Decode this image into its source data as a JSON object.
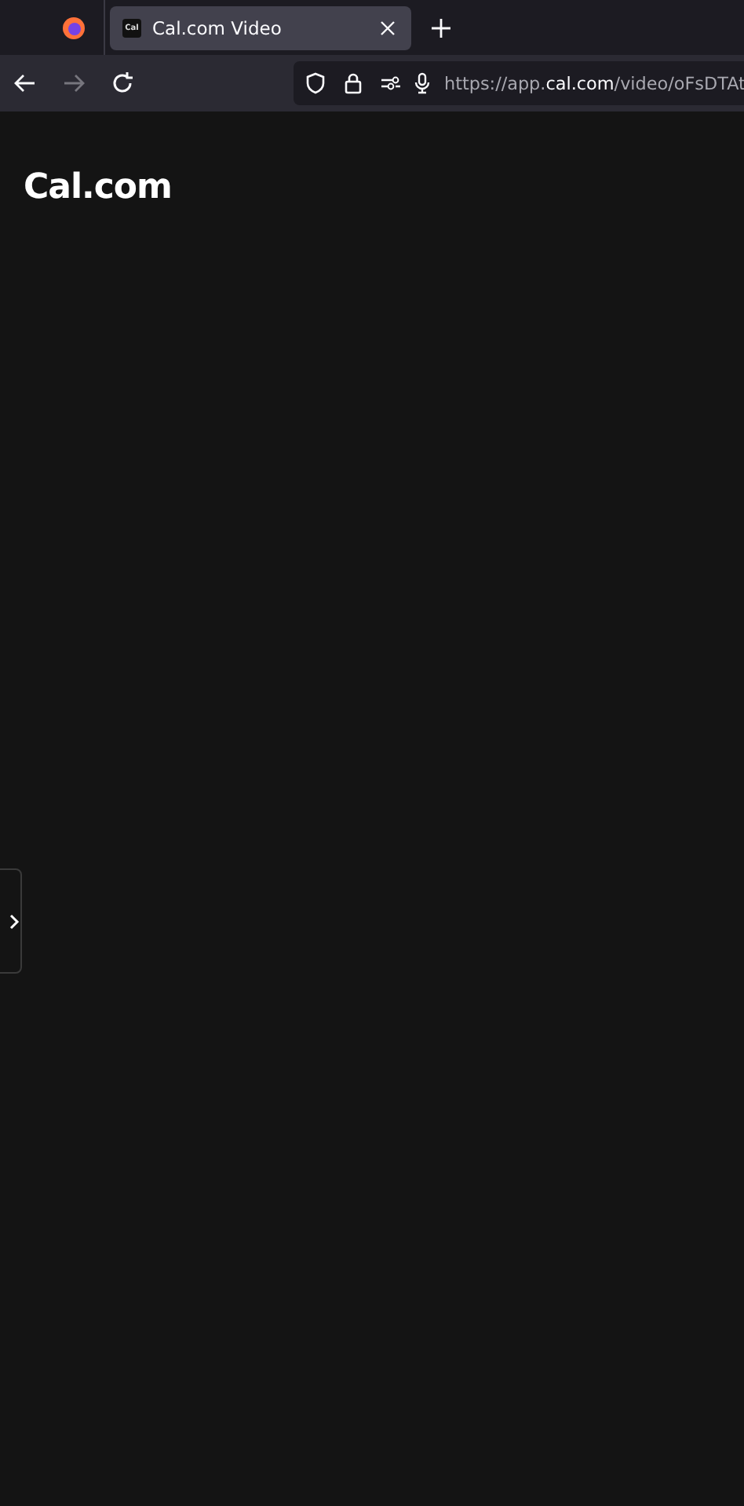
{
  "browser": {
    "tab": {
      "favicon_text": "Cal",
      "title": "Cal.com Video",
      "selected": true
    },
    "url": "https://app.**cal.com**/video/oFsDTAt"
  },
  "page": {
    "logo": "Cal.com"
  }
}
